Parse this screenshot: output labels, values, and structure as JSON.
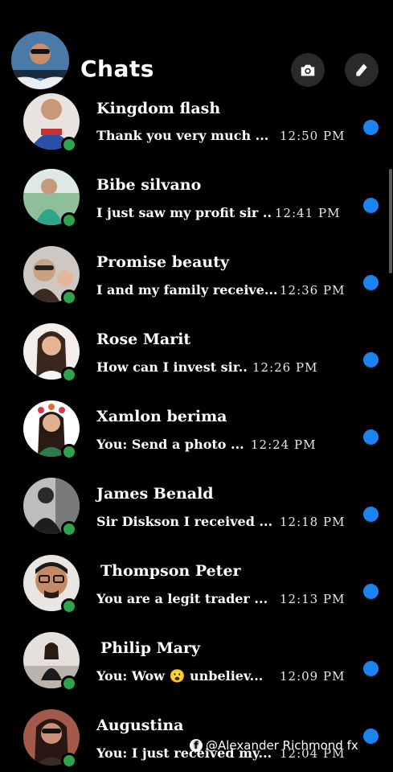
{
  "header": {
    "title": "Chats",
    "camera_icon": "camera-icon",
    "compose_icon": "pencil-icon"
  },
  "chats": [
    {
      "name": "Kingdom flash",
      "preview": "Thank you very much ...",
      "time": "12:50 PM",
      "online": true,
      "unread": true
    },
    {
      "name": "Bibe silvano",
      "preview": "I just saw my profit sir ..",
      "time": "12:41 PM",
      "online": true,
      "unread": true
    },
    {
      "name": "Promise beauty",
      "preview": "I and my family receive...",
      "time": "12:36 PM",
      "online": true,
      "unread": true
    },
    {
      "name": "Rose Marit",
      "preview": "How can I invest sir..",
      "time": "12:26 PM",
      "online": true,
      "unread": true
    },
    {
      "name": "Xamlon berima",
      "preview": "You: Send a photo ...",
      "time": "12:24 PM",
      "online": true,
      "unread": true
    },
    {
      "name": "James Benald",
      "preview": "Sir Diskson I received ...",
      "time": "12:18 PM",
      "online": true,
      "unread": true
    },
    {
      "name": "Thompson Peter",
      "preview": "You are a legit trader ...",
      "time": "12:13 PM",
      "online": true,
      "unread": true
    },
    {
      "name": "Philip Mary",
      "preview": "You: Wow 😮 unbeliev...",
      "time": "12:09 PM",
      "online": true,
      "unread": true
    },
    {
      "name": "Augustina",
      "preview": "You: I just received my...",
      "time": "12:04 PM",
      "online": true,
      "unread": true
    }
  ],
  "watermark": {
    "text": "@Alexander Richmond fx",
    "icon": "facebook-icon"
  },
  "colors": {
    "background": "#000000",
    "unread": "#1b84f0",
    "online": "#31a24c"
  }
}
